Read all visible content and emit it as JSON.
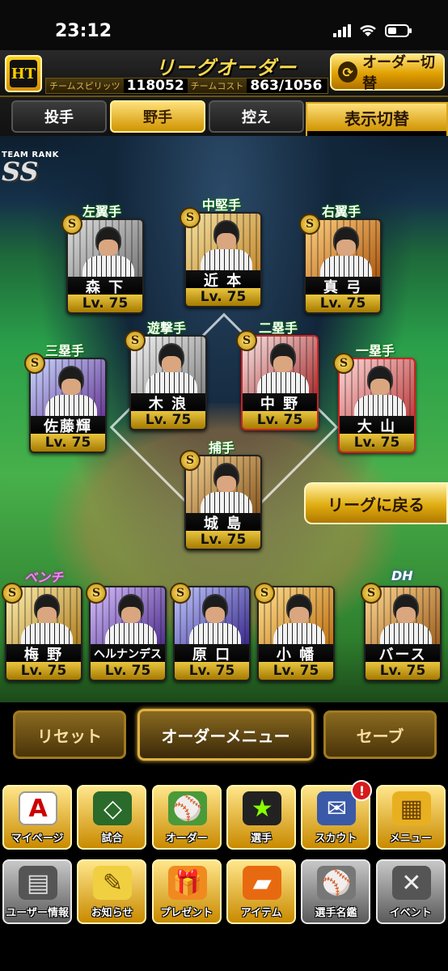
{
  "status_bar": {
    "time": "23:12"
  },
  "header": {
    "logo_text": "HT",
    "title": "リーグオーダー",
    "spirits_label": "チームスピリッツ",
    "spirits_value": "118052",
    "cost_label": "チームコスト",
    "cost_value": "863/1056",
    "order_switch_label": "オーダー切替"
  },
  "tabs": [
    {
      "label": "投手",
      "active": false
    },
    {
      "label": "野手",
      "active": true
    },
    {
      "label": "控え",
      "active": false
    }
  ],
  "display_toggle": {
    "label": "表示切替",
    "value": "－"
  },
  "team_rank": {
    "label": "TEAM RANK",
    "rank": "SS"
  },
  "lineup": [
    {
      "position": "左翼手",
      "name": "森 下",
      "level": "Lv. 75",
      "badge": "S"
    },
    {
      "position": "中堅手",
      "name": "近 本",
      "level": "Lv. 75",
      "badge": "S"
    },
    {
      "position": "右翼手",
      "name": "真 弓",
      "level": "Lv. 75",
      "badge": "S"
    },
    {
      "position": "遊撃手",
      "name": "木 浪",
      "level": "Lv. 75",
      "badge": "S"
    },
    {
      "position": "二塁手",
      "name": "中 野",
      "level": "Lv. 75",
      "badge": "S"
    },
    {
      "position": "三塁手",
      "name": "佐藤輝",
      "level": "Lv. 75",
      "badge": "S"
    },
    {
      "position": "一塁手",
      "name": "大 山",
      "level": "Lv. 75",
      "badge": "S"
    },
    {
      "position": "捕手",
      "name": "城 島",
      "level": "Lv. 75",
      "badge": "S"
    }
  ],
  "return_button": "リーグに戻る",
  "bench_label": "ベンチ",
  "dh_label": "DH",
  "bench": [
    {
      "name": "梅 野",
      "level": "Lv. 75",
      "badge": "S"
    },
    {
      "name": "ヘルナンデス",
      "level": "Lv. 75",
      "badge": "S"
    },
    {
      "name": "原 口",
      "level": "Lv. 75",
      "badge": "S"
    },
    {
      "name": "小 幡",
      "level": "Lv. 75",
      "badge": "S"
    }
  ],
  "dh": {
    "name": "バース",
    "level": "Lv. 75",
    "badge": "S"
  },
  "actions": {
    "reset": "リセット",
    "order_menu": "オーダーメニュー",
    "save": "セーブ"
  },
  "nav_row1": [
    {
      "label": "マイページ",
      "icon": "A"
    },
    {
      "label": "試合",
      "icon": "◇"
    },
    {
      "label": "オーダー",
      "icon": "⚾"
    },
    {
      "label": "選手",
      "icon": "★"
    },
    {
      "label": "スカウト",
      "icon": "✉",
      "notification": "!"
    },
    {
      "label": "メニュー",
      "icon": "▦"
    }
  ],
  "nav_row2": [
    {
      "label": "ユーザー情報",
      "icon": "▤"
    },
    {
      "label": "お知らせ",
      "icon": "✎"
    },
    {
      "label": "プレゼント",
      "icon": "🎁"
    },
    {
      "label": "アイテム",
      "icon": "▰"
    },
    {
      "label": "選手名鑑",
      "icon": "⚾"
    },
    {
      "label": "イベント",
      "icon": "✕"
    }
  ]
}
